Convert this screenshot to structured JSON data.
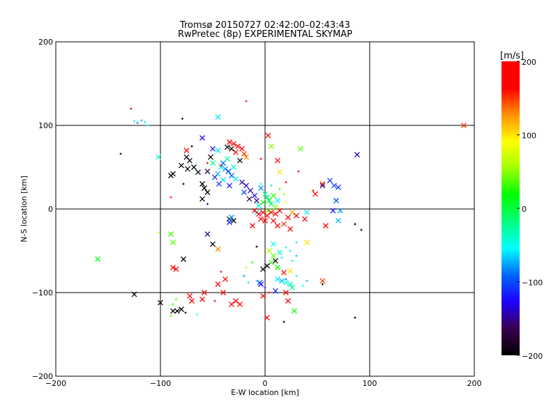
{
  "chart_data": {
    "type": "scatter",
    "title": "Tromsø 20150727 02:42:00–02:43:43",
    "subtitle": "RwPretec (8p) EXPERIMENTAL SKYMAP",
    "xlabel": "E-W location [km]",
    "ylabel": "N-S location [km]",
    "xlim": [
      -200,
      200
    ],
    "ylim": [
      -200,
      200
    ],
    "xticks": [
      -200,
      -100,
      0,
      100,
      200
    ],
    "yticks": [
      -200,
      -100,
      0,
      100,
      200
    ],
    "xtick_labels": [
      "−200",
      "−100",
      "0",
      "100",
      "200"
    ],
    "ytick_labels": [
      "−200",
      "−100",
      "0",
      "100",
      "200"
    ],
    "grid": true,
    "colorbar": {
      "label": "[m/s]",
      "range": [
        -200,
        200
      ],
      "ticks": [
        200,
        100,
        0,
        -100,
        -200
      ],
      "tick_labels": [
        "200",
        "100",
        "0",
        "−100",
        "−200"
      ],
      "colors": [
        "#000000",
        "#3a004f",
        "#1e00ff",
        "#0064ff",
        "#00ffff",
        "#00ff80",
        "#00ff00",
        "#a0ff00",
        "#ffff00",
        "#ff9000",
        "#ff0000",
        "#ff0000"
      ]
    },
    "points_format": [
      "x_km",
      "y_km",
      "velocity_ms",
      "marker"
    ],
    "points": [
      [
        -125,
        105,
        -60,
        "d"
      ],
      [
        -122,
        103,
        -80,
        "d"
      ],
      [
        -118,
        106,
        -70,
        "d"
      ],
      [
        -115,
        104,
        -60,
        "d"
      ],
      [
        -112,
        100,
        -50,
        "d"
      ],
      [
        -128,
        120,
        180,
        "d"
      ],
      [
        -45,
        110,
        -60,
        "x"
      ],
      [
        -79,
        108,
        -200,
        "d"
      ],
      [
        -18,
        129,
        200,
        "d"
      ],
      [
        -138,
        66,
        -200,
        "d"
      ],
      [
        -102,
        62,
        -40,
        "x"
      ],
      [
        -60,
        85,
        -130,
        "x"
      ],
      [
        -70,
        75,
        -200,
        "d"
      ],
      [
        -75,
        62,
        -200,
        "x"
      ],
      [
        -72,
        58,
        -200,
        "x"
      ],
      [
        -80,
        52,
        -200,
        "x"
      ],
      [
        -74,
        48,
        -200,
        "x"
      ],
      [
        -68,
        50,
        -200,
        "x"
      ],
      [
        -64,
        44,
        -200,
        "x"
      ],
      [
        -90,
        40,
        -200,
        "x"
      ],
      [
        -88,
        42,
        -200,
        "x"
      ],
      [
        -78,
        30,
        -200,
        "d"
      ],
      [
        -60,
        30,
        -200,
        "x"
      ],
      [
        -58,
        25,
        -200,
        "x"
      ],
      [
        -55,
        20,
        -200,
        "x"
      ],
      [
        -60,
        12,
        -200,
        "x"
      ],
      [
        -55,
        6,
        -150,
        "d"
      ],
      [
        -50,
        72,
        -120,
        "x"
      ],
      [
        -45,
        70,
        -60,
        "x"
      ],
      [
        -40,
        55,
        -90,
        "x"
      ],
      [
        -42,
        50,
        -60,
        "x"
      ],
      [
        -38,
        48,
        -80,
        "x"
      ],
      [
        -35,
        45,
        -100,
        "x"
      ],
      [
        -45,
        42,
        -70,
        "x"
      ],
      [
        -48,
        38,
        -110,
        "x"
      ],
      [
        -40,
        35,
        -60,
        "x"
      ],
      [
        -32,
        40,
        -90,
        "x"
      ],
      [
        -30,
        50,
        -40,
        "x"
      ],
      [
        -36,
        60,
        -30,
        "x"
      ],
      [
        -50,
        55,
        -20,
        "x"
      ],
      [
        -55,
        45,
        -170,
        "x"
      ],
      [
        -44,
        30,
        -100,
        "x"
      ],
      [
        -28,
        36,
        -60,
        "x"
      ],
      [
        -52,
        62,
        -200,
        "x"
      ],
      [
        -34,
        28,
        -120,
        "x"
      ],
      [
        -34,
        80,
        200,
        "x"
      ],
      [
        -30,
        78,
        190,
        "x"
      ],
      [
        -26,
        75,
        200,
        "x"
      ],
      [
        -22,
        72,
        180,
        "x"
      ],
      [
        -28,
        68,
        200,
        "x"
      ],
      [
        -20,
        66,
        150,
        "x"
      ],
      [
        -18,
        62,
        130,
        "x"
      ],
      [
        -32,
        72,
        -200,
        "x"
      ],
      [
        -24,
        58,
        -200,
        "x"
      ],
      [
        -36,
        74,
        -200,
        "x"
      ],
      [
        -42,
        52,
        200,
        "d"
      ],
      [
        -55,
        55,
        200,
        "d"
      ],
      [
        -75,
        70,
        200,
        "x"
      ],
      [
        -90,
        14,
        200,
        "d"
      ],
      [
        -22,
        32,
        -150,
        "x"
      ],
      [
        -18,
        28,
        -130,
        "x"
      ],
      [
        -14,
        22,
        -140,
        "x"
      ],
      [
        -20,
        20,
        -100,
        "x"
      ],
      [
        -10,
        16,
        -120,
        "x"
      ],
      [
        -8,
        10,
        -150,
        "x"
      ],
      [
        -15,
        12,
        -170,
        "x"
      ],
      [
        -4,
        25,
        -80,
        "x"
      ],
      [
        0,
        18,
        -30,
        "x"
      ],
      [
        2,
        14,
        -10,
        "x"
      ],
      [
        4,
        10,
        0,
        "x"
      ],
      [
        -2,
        8,
        20,
        "x"
      ],
      [
        6,
        6,
        -20,
        "x"
      ],
      [
        8,
        16,
        30,
        "x"
      ],
      [
        -6,
        4,
        -40,
        "x"
      ],
      [
        10,
        2,
        50,
        "x"
      ],
      [
        3,
        -2,
        40,
        "x"
      ],
      [
        12,
        10,
        -50,
        "x"
      ],
      [
        -4,
        30,
        -50,
        "d"
      ],
      [
        6,
        28,
        -40,
        "d"
      ],
      [
        14,
        24,
        30,
        "d"
      ],
      [
        18,
        18,
        60,
        "d"
      ],
      [
        20,
        8,
        90,
        "d"
      ],
      [
        -8,
        -4,
        -60,
        "x"
      ],
      [
        -10,
        -2,
        200,
        "x"
      ],
      [
        -6,
        -6,
        200,
        "x"
      ],
      [
        -2,
        -4,
        200,
        "x"
      ],
      [
        2,
        -8,
        200,
        "x"
      ],
      [
        6,
        -4,
        190,
        "x"
      ],
      [
        10,
        -6,
        180,
        "x"
      ],
      [
        14,
        -2,
        200,
        "x"
      ],
      [
        -4,
        -12,
        200,
        "x"
      ],
      [
        0,
        -14,
        200,
        "x"
      ],
      [
        8,
        -14,
        200,
        "x"
      ],
      [
        12,
        -20,
        200,
        "x"
      ],
      [
        18,
        -18,
        150,
        "x"
      ],
      [
        22,
        -10,
        170,
        "x"
      ],
      [
        26,
        -4,
        120,
        "x"
      ],
      [
        30,
        -8,
        200,
        "x"
      ],
      [
        24,
        -24,
        200,
        "x"
      ],
      [
        -12,
        -20,
        200,
        "x"
      ],
      [
        3,
        88,
        200,
        "x"
      ],
      [
        6,
        75,
        50,
        "x"
      ],
      [
        -4,
        60,
        200,
        "d"
      ],
      [
        12,
        58,
        200,
        "x"
      ],
      [
        14,
        44,
        100,
        "x"
      ],
      [
        20,
        32,
        200,
        "d"
      ],
      [
        34,
        72,
        40,
        "x"
      ],
      [
        32,
        45,
        200,
        "d"
      ],
      [
        40,
        -4,
        -60,
        "x"
      ],
      [
        48,
        18,
        200,
        "x"
      ],
      [
        46,
        22,
        160,
        "d"
      ],
      [
        55,
        30,
        150,
        "x"
      ],
      [
        55,
        28,
        -150,
        "x"
      ],
      [
        62,
        34,
        -110,
        "x"
      ],
      [
        66,
        28,
        -100,
        "x"
      ],
      [
        70,
        26,
        -110,
        "x"
      ],
      [
        65,
        -2,
        -120,
        "x"
      ],
      [
        68,
        10,
        -100,
        "x"
      ],
      [
        72,
        -2,
        -80,
        "x"
      ],
      [
        70,
        -14,
        -70,
        "x"
      ],
      [
        88,
        65,
        -140,
        "x"
      ],
      [
        86,
        -18,
        -200,
        "d"
      ],
      [
        92,
        -25,
        -200,
        "d"
      ],
      [
        38,
        -12,
        200,
        "x"
      ],
      [
        58,
        -20,
        200,
        "x"
      ],
      [
        190,
        100,
        150,
        "x"
      ],
      [
        -50,
        -42,
        -200,
        "x"
      ],
      [
        -45,
        -48,
        130,
        "x"
      ],
      [
        -55,
        -30,
        -150,
        "x"
      ],
      [
        -90,
        -30,
        30,
        "x"
      ],
      [
        -88,
        -40,
        40,
        "x"
      ],
      [
        -78,
        -60,
        -200,
        "x"
      ],
      [
        -85,
        -72,
        200,
        "x"
      ],
      [
        -88,
        -70,
        200,
        "x"
      ],
      [
        -102,
        -28,
        100,
        "d"
      ],
      [
        -160,
        -60,
        10,
        "x"
      ],
      [
        -42,
        -75,
        200,
        "d"
      ],
      [
        -38,
        -84,
        200,
        "x"
      ],
      [
        -45,
        -90,
        200,
        "x"
      ],
      [
        -34,
        -12,
        -200,
        "x"
      ],
      [
        -30,
        -14,
        -200,
        "x"
      ],
      [
        -32,
        -10,
        -80,
        "x"
      ],
      [
        -34,
        -16,
        -110,
        "x"
      ],
      [
        -18,
        -70,
        100,
        "d"
      ],
      [
        -12,
        -64,
        20,
        "d"
      ],
      [
        -8,
        -45,
        -200,
        "d"
      ],
      [
        -20,
        -80,
        -80,
        "d"
      ],
      [
        -16,
        -88,
        -60,
        "d"
      ],
      [
        -8,
        -86,
        -40,
        "d"
      ],
      [
        -4,
        -90,
        -130,
        "x"
      ],
      [
        -2,
        -72,
        -200,
        "x"
      ],
      [
        4,
        -50,
        60,
        "x"
      ],
      [
        8,
        -56,
        40,
        "x"
      ],
      [
        6,
        -64,
        30,
        "x"
      ],
      [
        10,
        -62,
        -200,
        "x"
      ],
      [
        2,
        -68,
        -200,
        "x"
      ],
      [
        12,
        -70,
        20,
        "x"
      ],
      [
        14,
        -52,
        -40,
        "x"
      ],
      [
        16,
        -58,
        -60,
        "d"
      ],
      [
        8,
        -42,
        -50,
        "x"
      ],
      [
        20,
        -46,
        -40,
        "d"
      ],
      [
        24,
        -50,
        -60,
        "d"
      ],
      [
        30,
        -56,
        -70,
        "d"
      ],
      [
        26,
        -62,
        -40,
        "d"
      ],
      [
        18,
        -76,
        200,
        "x"
      ],
      [
        24,
        -74,
        100,
        "x"
      ],
      [
        12,
        -84,
        -60,
        "x"
      ],
      [
        16,
        -86,
        -70,
        "x"
      ],
      [
        20,
        -88,
        -50,
        "x"
      ],
      [
        24,
        -90,
        -40,
        "x"
      ],
      [
        26,
        -94,
        -20,
        "x"
      ],
      [
        20,
        -84,
        -90,
        "d"
      ],
      [
        30,
        -80,
        -60,
        "d"
      ],
      [
        40,
        -86,
        -70,
        "d"
      ],
      [
        36,
        -92,
        -50,
        "d"
      ],
      [
        4,
        -100,
        200,
        "d"
      ],
      [
        10,
        -98,
        -110,
        "x"
      ],
      [
        20,
        -100,
        200,
        "x"
      ],
      [
        55,
        -86,
        150,
        "x"
      ],
      [
        55,
        -90,
        -200,
        "d"
      ],
      [
        40,
        -40,
        100,
        "x"
      ],
      [
        30,
        -40,
        -60,
        "d"
      ],
      [
        28,
        -122,
        20,
        "x"
      ],
      [
        22,
        -110,
        200,
        "x"
      ],
      [
        -5,
        -88,
        -100,
        "x"
      ],
      [
        0,
        -94,
        -120,
        "d"
      ],
      [
        -2,
        -104,
        200,
        "x"
      ],
      [
        2,
        -130,
        200,
        "x"
      ],
      [
        18,
        -135,
        -200,
        "d"
      ],
      [
        86,
        -130,
        -200,
        "d"
      ],
      [
        -28,
        -110,
        200,
        "x"
      ],
      [
        -32,
        -114,
        200,
        "x"
      ],
      [
        -24,
        -114,
        200,
        "x"
      ],
      [
        -40,
        -100,
        200,
        "x"
      ],
      [
        -58,
        -100,
        200,
        "x"
      ],
      [
        -60,
        -108,
        200,
        "x"
      ],
      [
        -70,
        -110,
        200,
        "x"
      ],
      [
        -72,
        -104,
        200,
        "x"
      ],
      [
        -85,
        -108,
        40,
        "d"
      ],
      [
        -88,
        -122,
        -200,
        "x"
      ],
      [
        -84,
        -122,
        -200,
        "x"
      ],
      [
        -80,
        -120,
        -200,
        "x"
      ],
      [
        -76,
        -124,
        -200,
        "d"
      ],
      [
        -90,
        -128,
        40,
        "d"
      ],
      [
        -88,
        -114,
        30,
        "d"
      ],
      [
        -65,
        -126,
        -50,
        "d"
      ],
      [
        -48,
        -110,
        200,
        "d"
      ],
      [
        -125,
        -102,
        -200,
        "x"
      ],
      [
        -100,
        -112,
        -200,
        "x"
      ]
    ]
  }
}
